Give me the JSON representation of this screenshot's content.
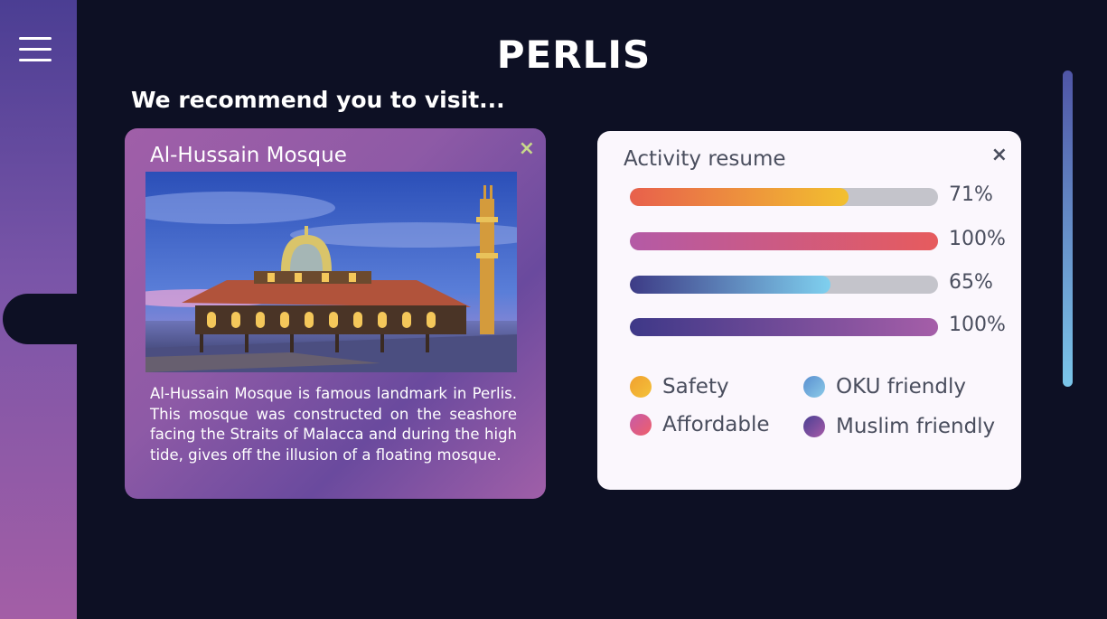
{
  "header": {
    "title": "PERLIS",
    "subtitle": "We recommend you to visit..."
  },
  "place": {
    "name": "Al-Hussain Mosque",
    "close_label": "×",
    "description": "Al-Hussain Mosque is famous landmark in Perlis. This mosque was constructed on the seashore facing the Straits of Malacca and during the high tide, gives off the illusion of a floating mosque."
  },
  "activity": {
    "title": "Activity resume",
    "close_label": "×",
    "bars": [
      {
        "percent": 71,
        "label": "71%",
        "gradient": [
          "#e8604c",
          "#f2c02f"
        ]
      },
      {
        "percent": 100,
        "label": "100%",
        "gradient": [
          "#b45aa6",
          "#e85b5b"
        ]
      },
      {
        "percent": 65,
        "label": "65%",
        "gradient": [
          "#3d3b86",
          "#7fd0ef"
        ]
      },
      {
        "percent": 100,
        "label": "100%",
        "gradient": [
          "#3e3888",
          "#a85fa9"
        ]
      }
    ],
    "legend": [
      {
        "label": "Safety",
        "colors": [
          "#f0a02f",
          "#f4c23a"
        ]
      },
      {
        "label": "OKU friendly",
        "colors": [
          "#5a8fd0",
          "#8bcbe8"
        ]
      },
      {
        "label": "Affordable",
        "colors": [
          "#c65aa8",
          "#ef5f6a"
        ]
      },
      {
        "label": "Muslim friendly",
        "colors": [
          "#4a3f93",
          "#a75ba8"
        ]
      }
    ]
  }
}
